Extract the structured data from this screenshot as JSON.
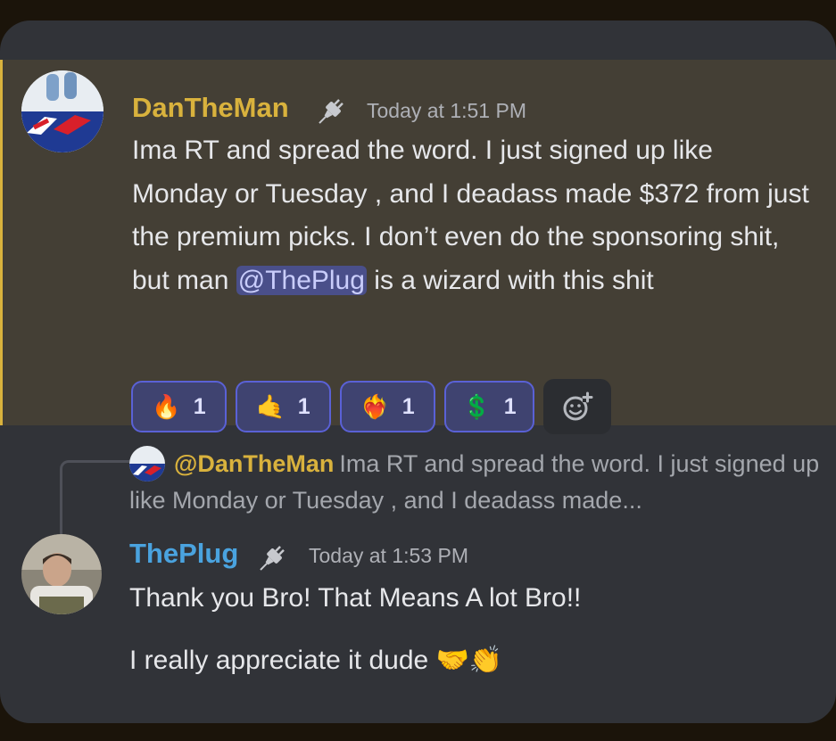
{
  "message1": {
    "author": "DanTheMan",
    "author_color": "#d9b23d",
    "timestamp": "Today at 1:51 PM",
    "text_before_mention": "Ima RT and spread the word. I just signed up like Monday or Tuesday , and I deadass made  $372 from just the premium picks. I don’t even do the sponsoring shit, but man ",
    "mention": "@ThePlug",
    "text_after_mention": " is a wizard with this shit",
    "reactions": [
      {
        "emoji": "🔥",
        "count": "1",
        "icon": "fire-icon"
      },
      {
        "emoji": "🤙",
        "count": "1",
        "icon": "call-me-hand-icon"
      },
      {
        "emoji": "❤️‍🔥",
        "count": "1",
        "icon": "heart-on-fire-icon"
      },
      {
        "emoji": "💲",
        "count": "1",
        "icon": "dollar-sign-icon"
      }
    ],
    "add_reaction_icon": "add-reaction-icon"
  },
  "reply": {
    "mention": "@DanTheMan",
    "preview": "Ima RT and spread the word. I just signed up like Monday or Tuesday , and I deadass made..."
  },
  "message2": {
    "author": "ThePlug",
    "author_color": "#4aa3df",
    "timestamp": "Today at 1:53 PM",
    "line1": "Thank you Bro! That Means A lot Bro!!",
    "line2_text": "I really appreciate it dude ",
    "line2_emojis": "🤝👏"
  }
}
